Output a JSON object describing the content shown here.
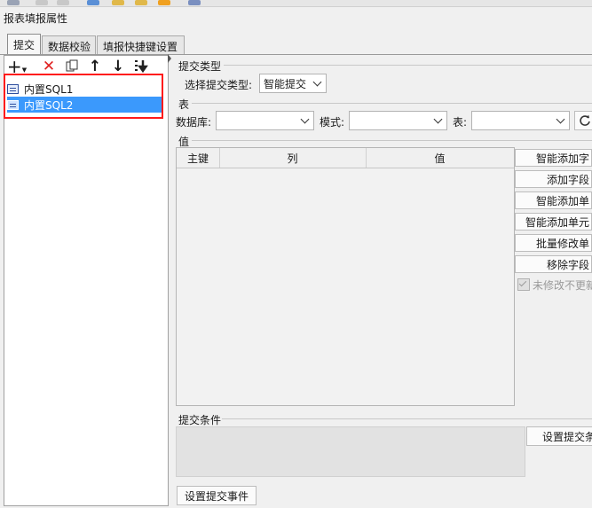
{
  "window": {
    "title": "报表填报属性"
  },
  "tabs": [
    {
      "label": "提交",
      "active": true
    },
    {
      "label": "数据校验",
      "active": false
    },
    {
      "label": "填报快捷键设置",
      "active": false
    }
  ],
  "left_toolbar": {
    "icons": [
      "add-icon",
      "delete-icon",
      "copy-icon",
      "move-up-icon",
      "move-down-icon",
      "sort-icon"
    ],
    "glyphs": {
      "add": "+",
      "delete": "✕",
      "up": "↑",
      "down": "↓"
    },
    "colors": {
      "delete": "#e02020"
    }
  },
  "tree": {
    "items": [
      {
        "label": "内置SQL1",
        "selected": false
      },
      {
        "label": "内置SQL2",
        "selected": true
      }
    ],
    "selection_color": "#3b99fc",
    "highlight_box_color": "#ff1a1a"
  },
  "submit_type": {
    "section_label": "提交类型",
    "select_label": "选择提交类型:",
    "value": "智能提交"
  },
  "table_section": {
    "section_label": "表",
    "database_label": "数据库:",
    "database_value": "",
    "schema_label": "模式:",
    "schema_value": "",
    "table_label": "表:",
    "table_value": ""
  },
  "values": {
    "section_label": "值",
    "columns": [
      "主键",
      "列",
      "值"
    ],
    "rows": []
  },
  "value_buttons": [
    "智能添加字",
    "添加字段",
    "智能添加单",
    "智能添加单元",
    "批量修改单",
    "移除字段"
  ],
  "unchanged_checkbox": {
    "label": "未修改不更新",
    "checked": true,
    "enabled": false
  },
  "conditions": {
    "section_label": "提交条件",
    "button": "设置提交条"
  },
  "event_button": "设置提交事件"
}
